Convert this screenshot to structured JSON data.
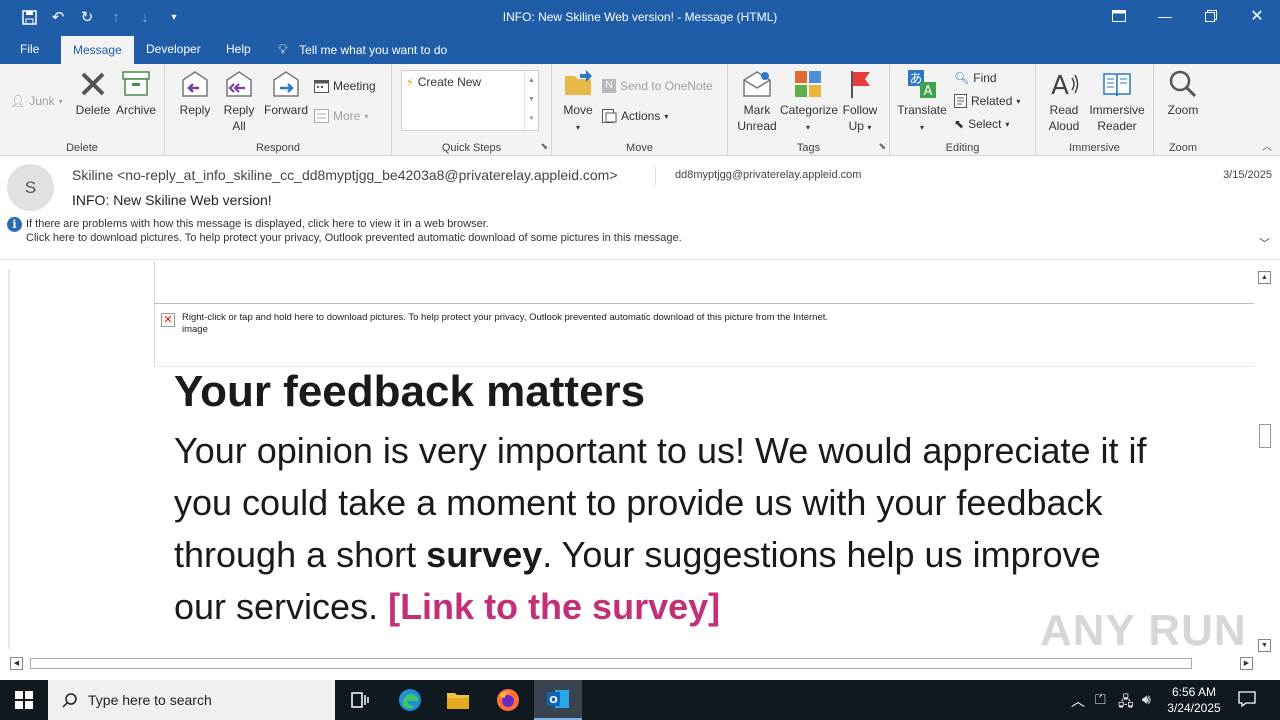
{
  "window": {
    "title": "INFO: New Skiline Web version!  -  Message (HTML)"
  },
  "menu": {
    "tabs": [
      "File",
      "Message",
      "Developer",
      "Help"
    ],
    "tell_me": "Tell me what you want to do"
  },
  "ribbon": {
    "delete_group": {
      "junk": "Junk",
      "delete": "Delete",
      "archive": "Archive",
      "label": "Delete"
    },
    "respond_group": {
      "reply": "Reply",
      "reply_all_1": "Reply",
      "reply_all_2": "All",
      "forward": "Forward",
      "meeting": "Meeting",
      "more": "More",
      "label": "Respond"
    },
    "quicksteps_group": {
      "create_new": "Create New",
      "label": "Quick Steps"
    },
    "move_group": {
      "move": "Move",
      "onenote": "Send to OneNote",
      "actions": "Actions",
      "label": "Move"
    },
    "tags_group": {
      "mark_1": "Mark",
      "mark_2": "Unread",
      "categorize": "Categorize",
      "follow_1": "Follow",
      "follow_2": "Up",
      "label": "Tags"
    },
    "editing_group": {
      "translate": "Translate",
      "find": "Find",
      "related": "Related",
      "select": "Select",
      "label": "Editing"
    },
    "immersive_group": {
      "read_1": "Read",
      "read_2": "Aloud",
      "reader_1": "Immersive",
      "reader_2": "Reader",
      "label": "Immersive"
    },
    "zoom_group": {
      "zoom": "Zoom",
      "label": "Zoom"
    }
  },
  "message": {
    "avatar_letter": "S",
    "from": "Skiline <no-reply_at_info_skiline_cc_dd8myptjgg_be4203a8@privaterelay.appleid.com>",
    "to": "dd8myptjgg@privaterelay.appleid.com",
    "date": "3/15/2025",
    "subject": "INFO: New Skiline Web version!",
    "info_line1": "If there are problems with how this message is displayed, click here to view it in a web browser.",
    "info_line2": "Click here to download pictures. To help protect your privacy, Outlook prevented automatic download of some pictures in this message."
  },
  "body": {
    "blocked_image_msg": "Right-click or tap and hold here to download pictures. To help protect your privacy, Outlook prevented automatic download of this picture from the Internet.",
    "blocked_image_alt": "image",
    "heading": "Your feedback matters",
    "para_part1": "Your opinion is very important to us! We would appreciate it if you could take a moment to provide us with your feedback through a short ",
    "para_bold": "survey",
    "para_part2": ". Your suggestions help us improve our services. ",
    "link_text": "[Link to the survey]",
    "link_color": "#c2307a"
  },
  "taskbar": {
    "search_placeholder": "Type here to search",
    "time": "6:56 AM",
    "date": "3/24/2025"
  },
  "watermark": "ANY RUN"
}
